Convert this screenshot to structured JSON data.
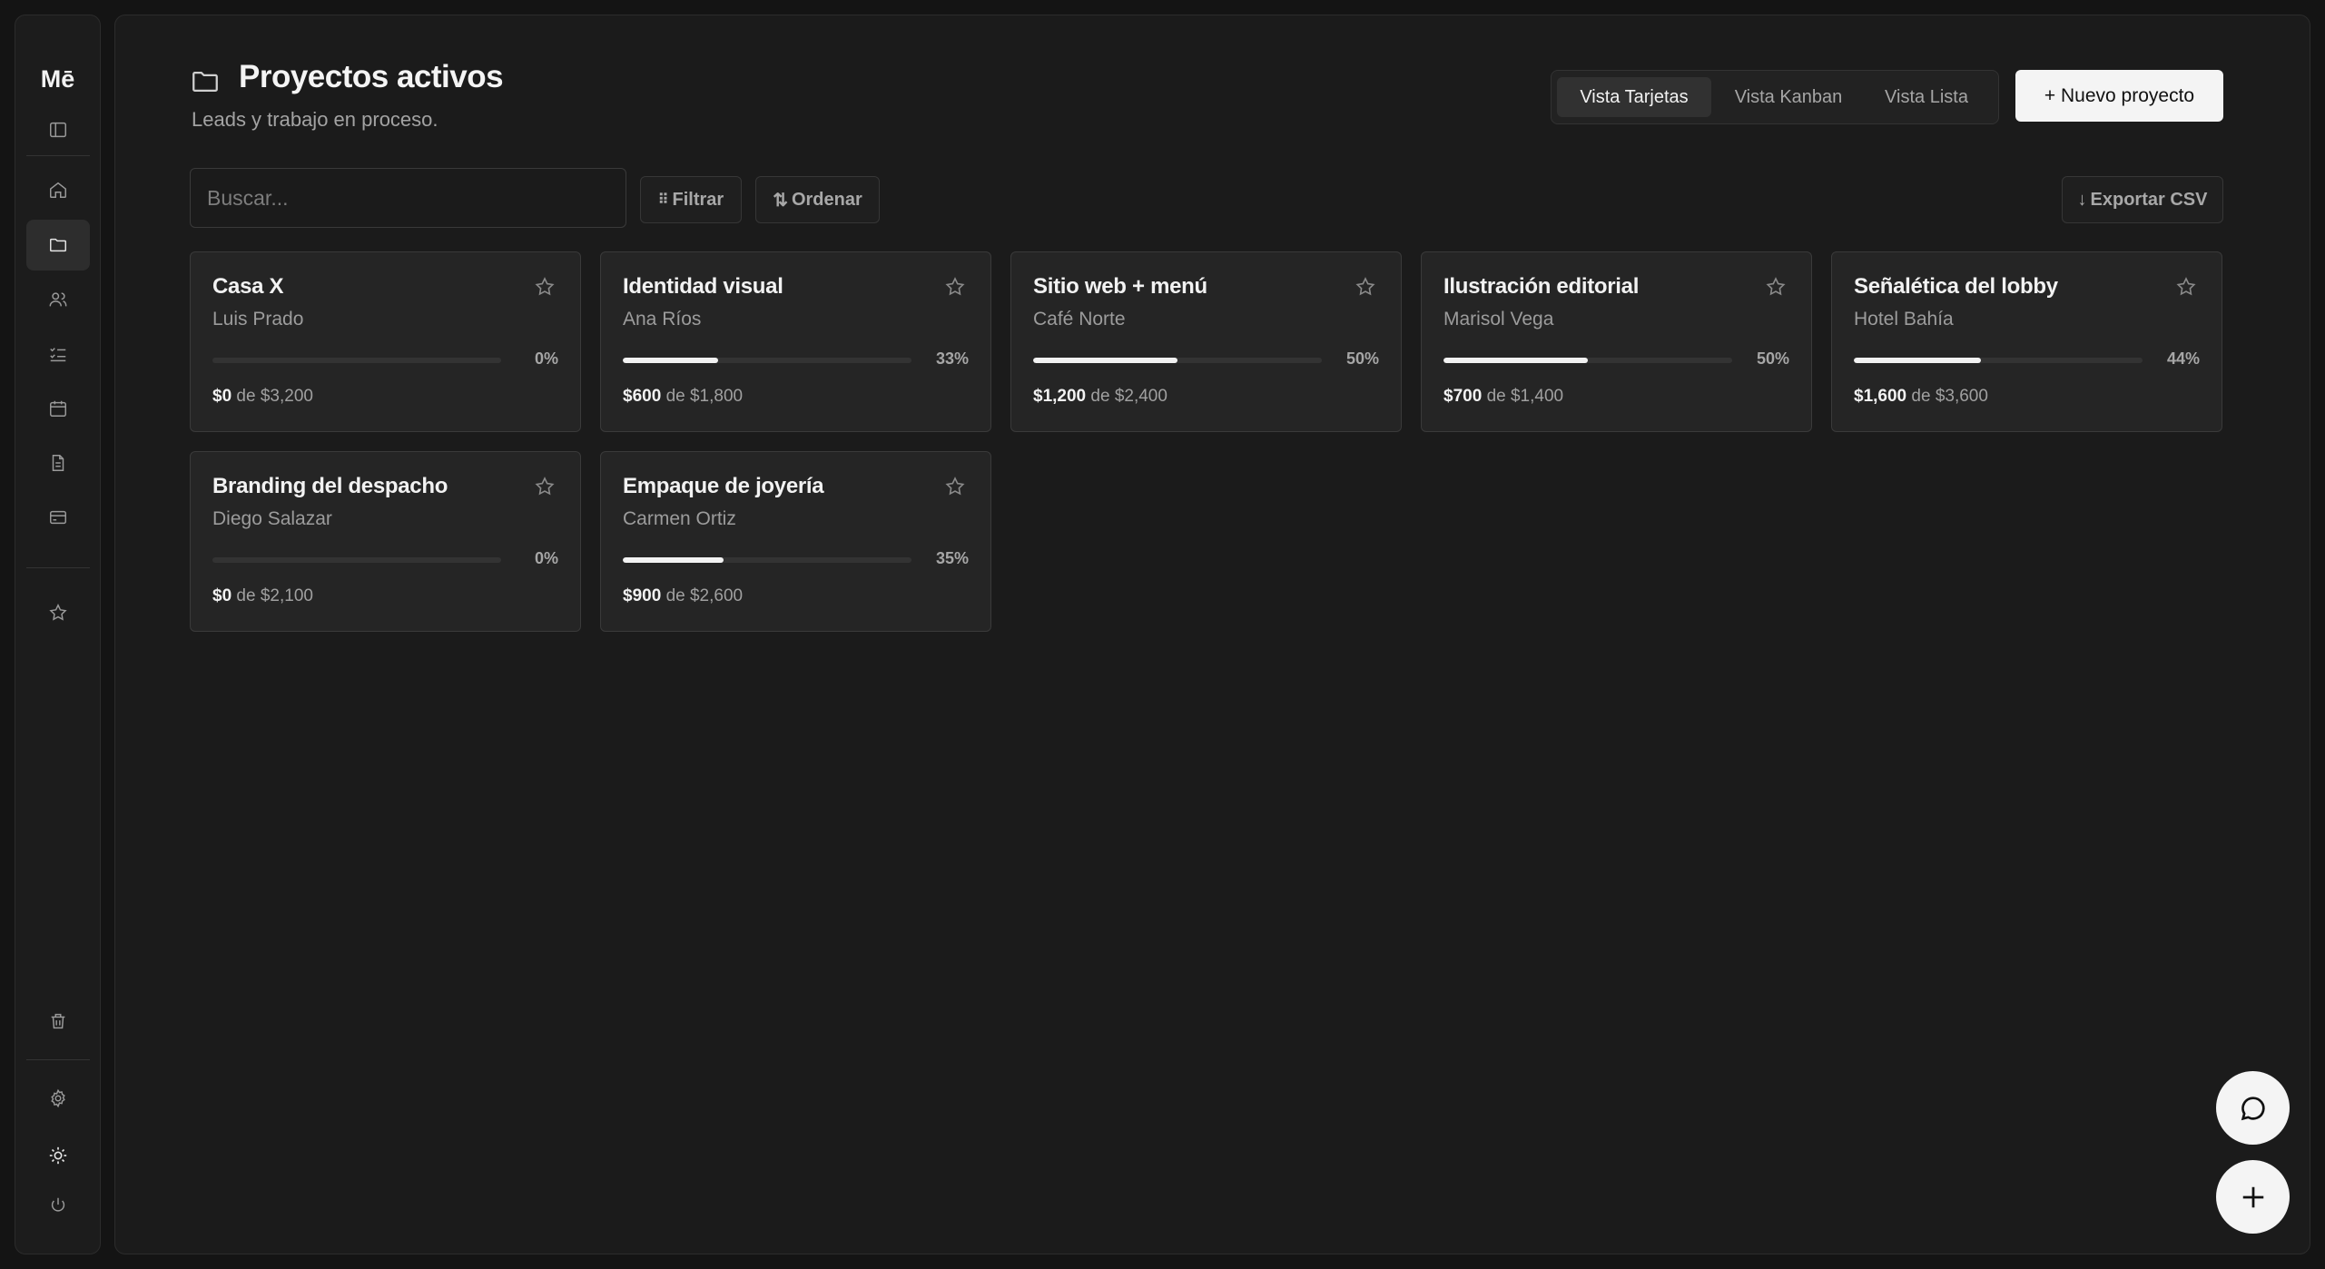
{
  "sidebar": {
    "logo": "Mē",
    "items": [
      {
        "name": "sidebar-toggle",
        "icon": "panel-left-icon"
      },
      {
        "name": "home",
        "icon": "home-icon"
      },
      {
        "name": "projects",
        "icon": "folder-icon",
        "active": true
      },
      {
        "name": "clients",
        "icon": "users-icon"
      },
      {
        "name": "tasks",
        "icon": "checklist-icon"
      },
      {
        "name": "calendar",
        "icon": "calendar-icon"
      },
      {
        "name": "documents",
        "icon": "file-icon"
      },
      {
        "name": "payments",
        "icon": "credit-card-icon"
      },
      {
        "name": "favorites",
        "icon": "star-icon"
      },
      {
        "name": "trash",
        "icon": "trash-icon"
      },
      {
        "name": "settings",
        "icon": "gear-icon"
      },
      {
        "name": "theme",
        "icon": "sun-icon"
      },
      {
        "name": "logout",
        "icon": "power-icon"
      }
    ]
  },
  "header": {
    "title": "Proyectos activos",
    "subtitle": "Leads y trabajo en proceso.",
    "views": [
      "Vista Tarjetas",
      "Vista Kanban",
      "Vista Lista"
    ],
    "active_view": "Vista Tarjetas",
    "new_button": "+ Nuevo proyecto"
  },
  "toolbar": {
    "search_placeholder": "Buscar...",
    "filter_label": "Filtrar",
    "sort_label": "Ordenar",
    "export_label": "Exportar CSV"
  },
  "amount_connector": "de",
  "projects": [
    {
      "title": "Casa X",
      "client": "Luis Prado",
      "progress": 0,
      "progress_label": "0%",
      "paid": "$0",
      "total": "$3,200"
    },
    {
      "title": "Identidad visual",
      "client": "Ana Ríos",
      "progress": 33,
      "progress_label": "33%",
      "paid": "$600",
      "total": "$1,800"
    },
    {
      "title": "Sitio web + menú",
      "client": "Café Norte",
      "progress": 50,
      "progress_label": "50%",
      "paid": "$1,200",
      "total": "$2,400"
    },
    {
      "title": "Ilustración editorial",
      "client": "Marisol Vega",
      "progress": 50,
      "progress_label": "50%",
      "paid": "$700",
      "total": "$1,400"
    },
    {
      "title": "Señalética del lobby",
      "client": "Hotel Bahía",
      "progress": 44,
      "progress_label": "44%",
      "paid": "$1,600",
      "total": "$3,600"
    },
    {
      "title": "Branding del despacho",
      "client": "Diego Salazar",
      "progress": 0,
      "progress_label": "0%",
      "paid": "$0",
      "total": "$2,100"
    },
    {
      "title": "Empaque de joyería",
      "client": "Carmen Ortiz",
      "progress": 35,
      "progress_label": "35%",
      "paid": "$900",
      "total": "$2,600"
    }
  ],
  "fabs": {
    "chat": "chat-bubble-icon",
    "add": "plus-icon"
  }
}
